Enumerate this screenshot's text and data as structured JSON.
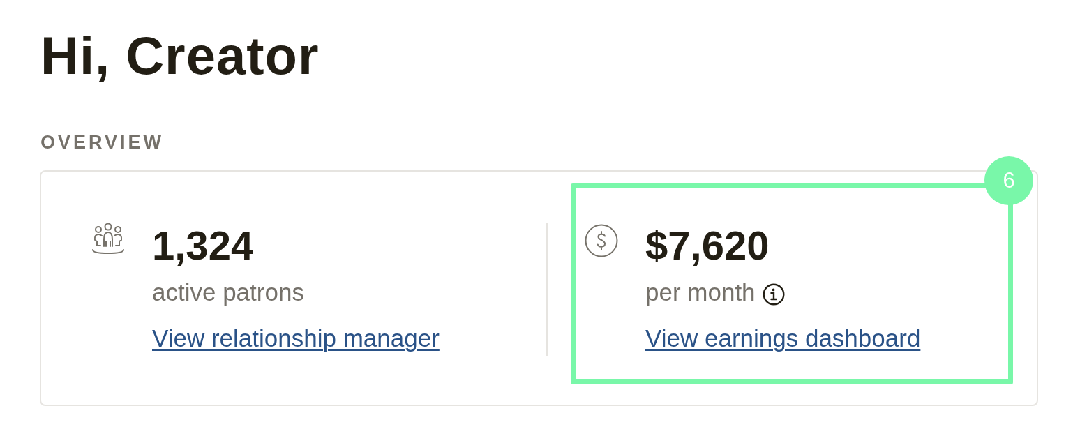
{
  "greeting": "Hi, Creator",
  "section_label": "OVERVIEW",
  "stats": [
    {
      "kind": "people",
      "value": "1,324",
      "caption": "active patrons",
      "info": false,
      "link": "View relationship manager",
      "highlighted": false
    },
    {
      "kind": "money",
      "value": "$7,620",
      "caption": "per month",
      "info": true,
      "link": "View earnings dashboard",
      "highlighted": true,
      "badge": "6"
    }
  ]
}
